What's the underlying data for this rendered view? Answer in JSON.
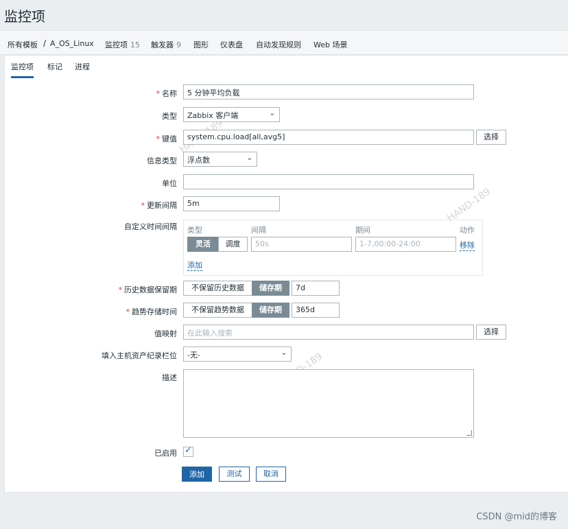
{
  "page": {
    "title": "监控项"
  },
  "breadcrumb": {
    "items": [
      {
        "label": "所有模板",
        "count": ""
      },
      {
        "label": "A_OS_Linux",
        "count": ""
      },
      {
        "label": "监控项",
        "count": "15"
      },
      {
        "label": "触发器",
        "count": "9"
      },
      {
        "label": "图形",
        "count": ""
      },
      {
        "label": "仪表盘",
        "count": ""
      },
      {
        "label": "自动发现规则",
        "count": ""
      },
      {
        "label": "Web 场景",
        "count": ""
      }
    ],
    "separator": "/"
  },
  "tabs": [
    "监控项",
    "标记",
    "进程"
  ],
  "form": {
    "name": {
      "label": "名称",
      "value": "5 分钟平均负载"
    },
    "type": {
      "label": "类型",
      "value": "Zabbix 客户端"
    },
    "key": {
      "label": "键值",
      "value": "system.cpu.load[all,avg5]",
      "button": "选择"
    },
    "info_type": {
      "label": "信息类型",
      "value": "浮点数"
    },
    "units": {
      "label": "单位",
      "value": ""
    },
    "update_interval": {
      "label": "更新间隔",
      "value": "5m"
    },
    "custom_intervals": {
      "label": "自定义时间间隔",
      "headers": [
        "类型",
        "间隔",
        "期间",
        "动作"
      ],
      "row": {
        "type_on": "灵活",
        "type_off": "调度",
        "interval_placeholder": "50s",
        "period_placeholder": "1-7,00:00-24:00",
        "action": "移除"
      },
      "add": "添加"
    },
    "history": {
      "label": "历史数据保留期",
      "option_off": "不保留历史数据",
      "option_on": "储存期",
      "value": "7d"
    },
    "trends": {
      "label": "趋势存储时间",
      "option_off": "不保留趋势数据",
      "option_on": "储存期",
      "value": "365d"
    },
    "valuemap": {
      "label": "值映射",
      "placeholder": "在此输入搜索",
      "button": "选择"
    },
    "inventory": {
      "label": "填入主机资产纪录栏位",
      "value": "-无-"
    },
    "description": {
      "label": "描述",
      "value": ""
    },
    "enabled": {
      "label": "已启用",
      "checked": true
    },
    "buttons": {
      "add": "添加",
      "test": "测试",
      "cancel": "取消"
    }
  },
  "watermark": "HAND-189",
  "footer": "CSDN @mid的博客"
}
